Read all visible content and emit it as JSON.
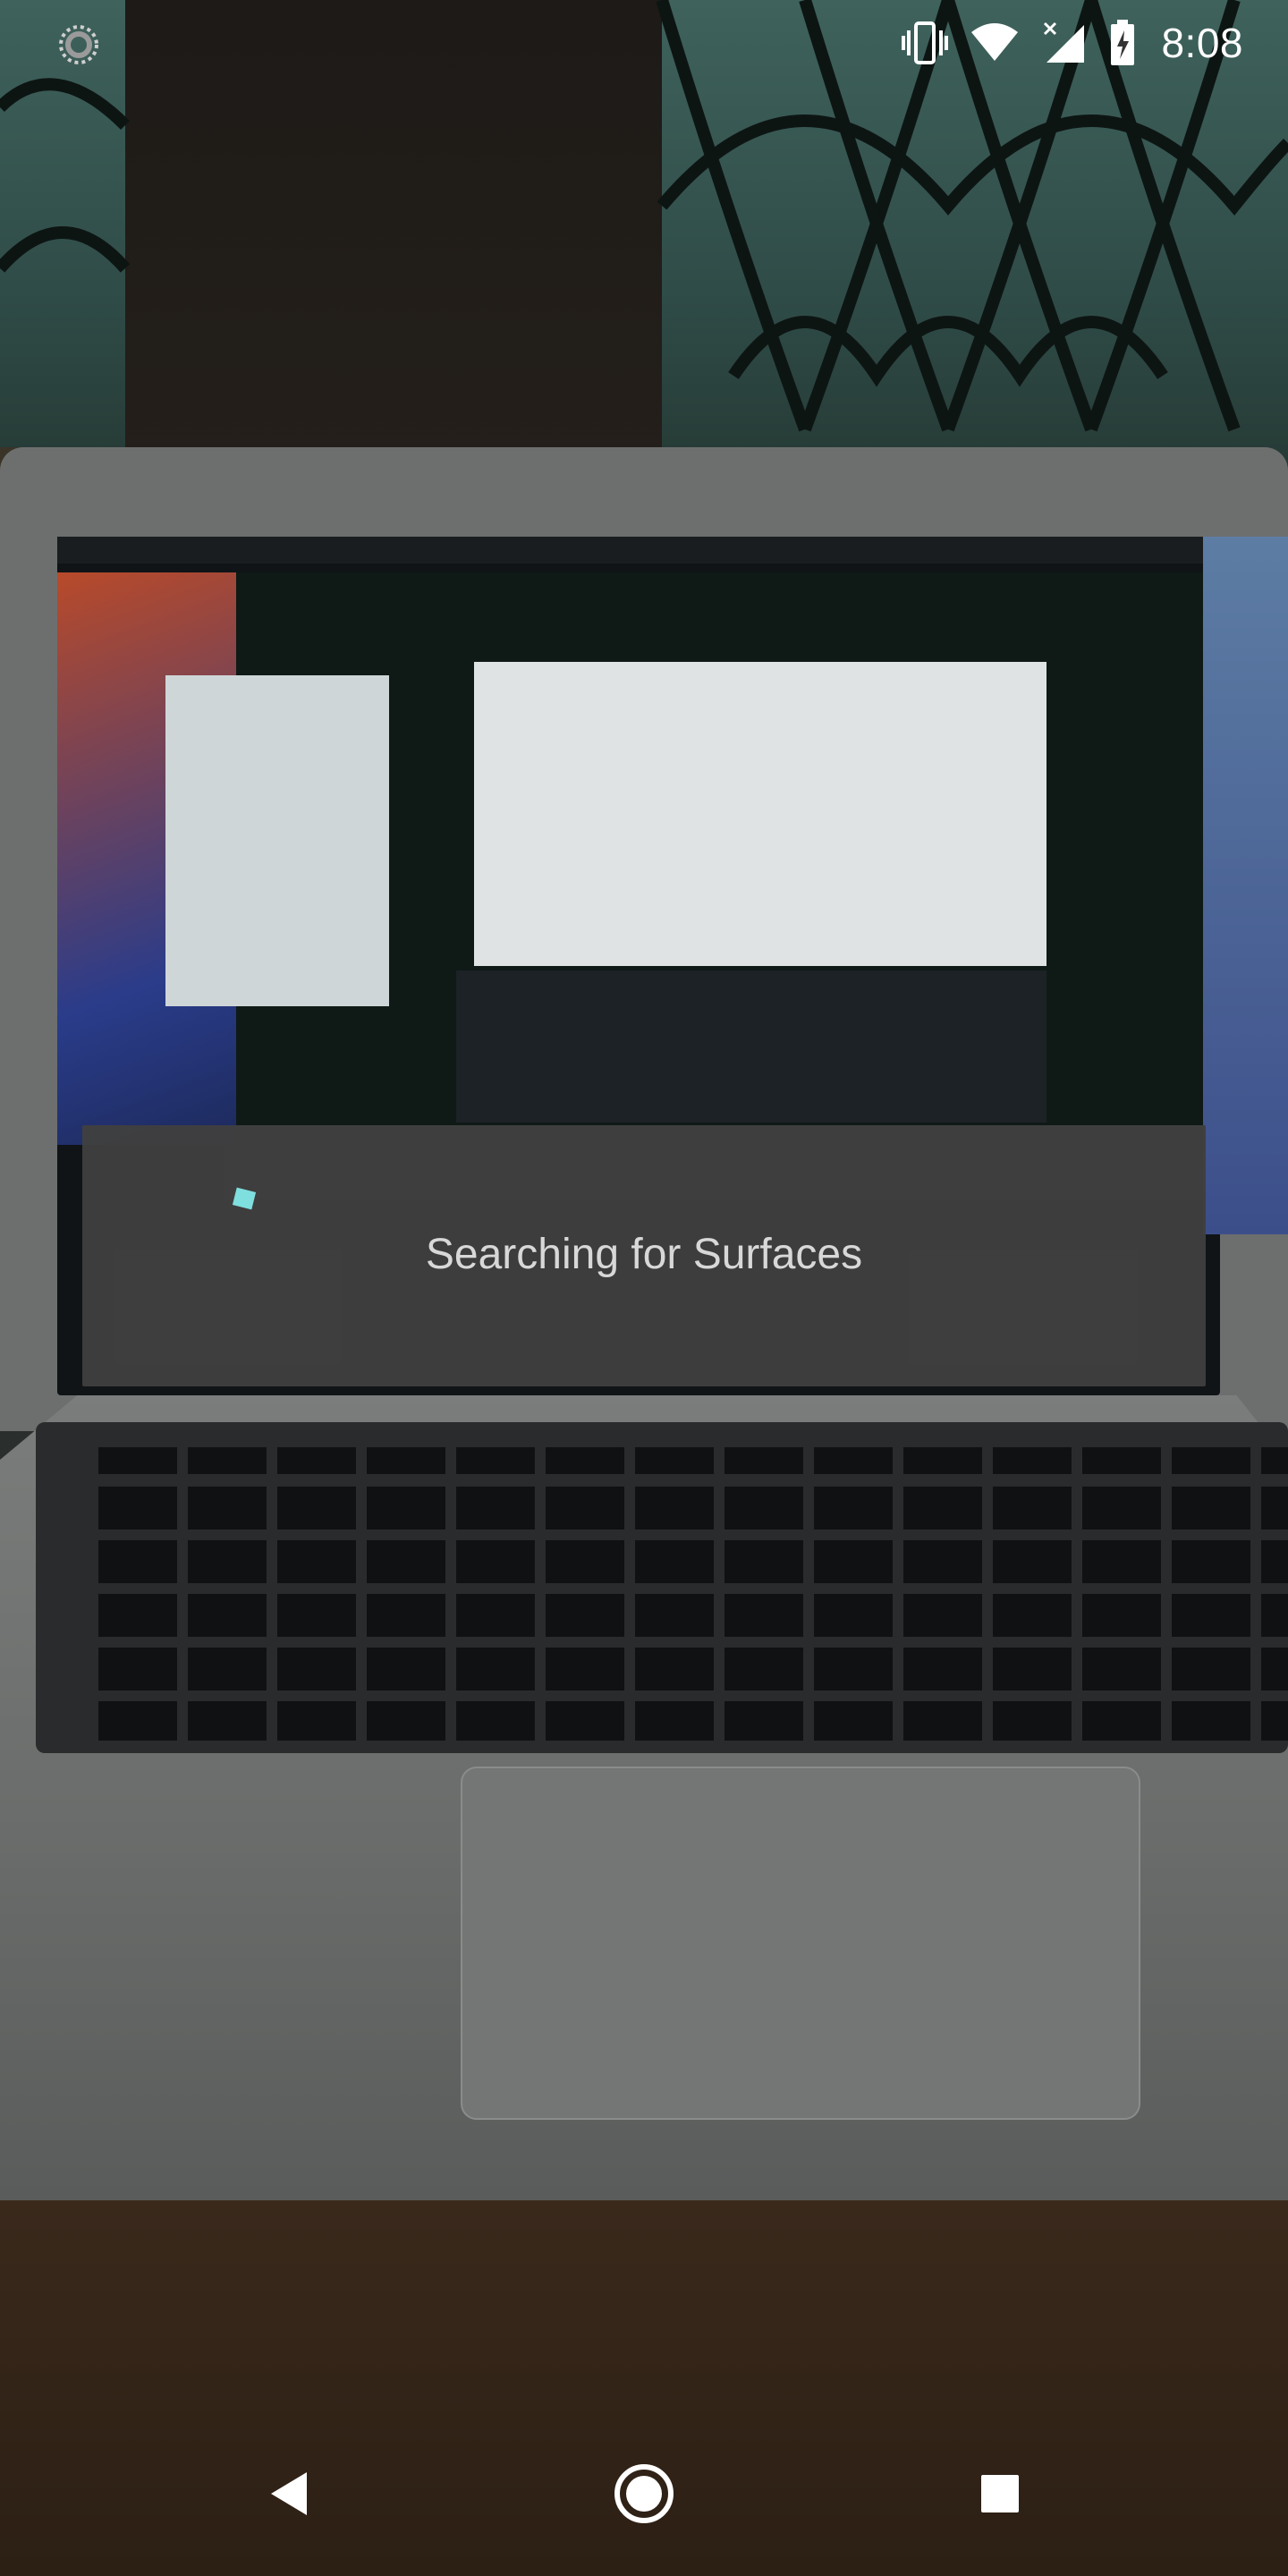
{
  "status_bar": {
    "time": "8:08",
    "left_icon": "loading-indicator-icon",
    "icons": [
      "vibrate-icon",
      "wifi-icon",
      "cellular-no-signal-icon",
      "battery-charging-icon"
    ]
  },
  "ar_overlay": {
    "message": "Searching for Surfaces",
    "spinner_icon": "loading-spinner-icon",
    "spinner_color": "#7fdede"
  },
  "nav_bar": {
    "back_icon": "back-triangle-icon",
    "home_icon": "home-circle-icon",
    "recents_icon": "recents-square-icon"
  }
}
